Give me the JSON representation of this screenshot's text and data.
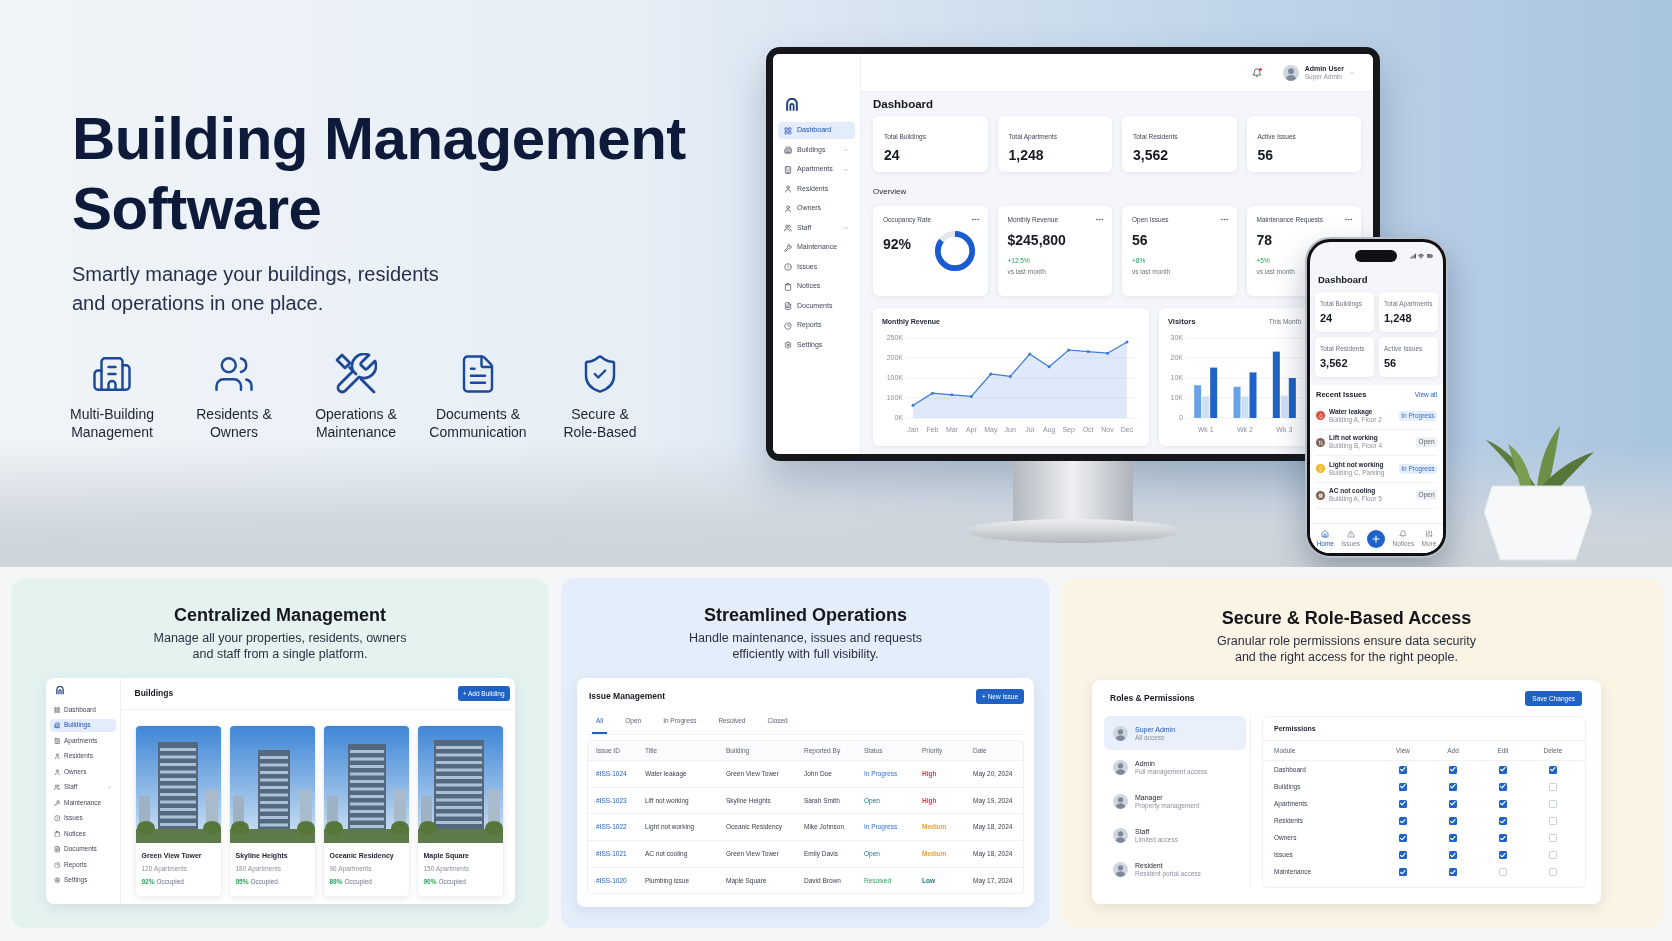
{
  "hero": {
    "title": "Building Management\nSoftware",
    "subtitle": "Smartly manage your buildings, residents\nand operations in one place.",
    "features": [
      {
        "label": "Multi-Building\nManagement"
      },
      {
        "label": "Residents &\nOwners"
      },
      {
        "label": "Operations &\nMaintenance"
      },
      {
        "label": "Documents &\nCommunication"
      },
      {
        "label": "Secure &\nRole-Based"
      }
    ]
  },
  "monitor": {
    "header": {
      "has_notification": true,
      "user_name": "Admin User",
      "user_role": "Super Admin"
    },
    "sidebar": [
      {
        "label": "Dashboard",
        "selected": true,
        "expandable": false
      },
      {
        "label": "Buildings",
        "selected": false,
        "expandable": true
      },
      {
        "label": "Apartments",
        "selected": false,
        "expandable": true
      },
      {
        "label": "Residents",
        "selected": false,
        "expandable": false
      },
      {
        "label": "Owners",
        "selected": false,
        "expandable": false
      },
      {
        "label": "Staff",
        "selected": false,
        "expandable": true
      },
      {
        "label": "Maintenance",
        "selected": false,
        "expandable": false
      },
      {
        "label": "Issues",
        "selected": false,
        "expandable": false
      },
      {
        "label": "Notices",
        "selected": false,
        "expandable": false
      },
      {
        "label": "Documents",
        "selected": false,
        "expandable": false
      },
      {
        "label": "Reports",
        "selected": false,
        "expandable": false
      },
      {
        "label": "Settings",
        "selected": false,
        "expandable": false
      }
    ],
    "page_title": "Dashboard",
    "stats": [
      {
        "label": "Total Buildings",
        "value": "24"
      },
      {
        "label": "Total Apartments",
        "value": "1,248"
      },
      {
        "label": "Total Residents",
        "value": "3,562"
      },
      {
        "label": "Active Issues",
        "value": "56"
      }
    ],
    "overview_title": "Overview",
    "overview": [
      {
        "kind": "donut",
        "label": "Occupancy Rate",
        "value": "92%",
        "level": 0.85
      },
      {
        "kind": "trend",
        "label": "Monthly Revenue",
        "value": "$245,800",
        "change": "+12.5%",
        "note": "vs last month"
      },
      {
        "kind": "trend",
        "label": "Open Issues",
        "value": "56",
        "change": "+8%",
        "note": "vs last month"
      },
      {
        "kind": "trend",
        "label": "Maintenance Requests",
        "value": "78",
        "change": "+5%",
        "note": "vs last month"
      }
    ],
    "revenue_chart": {
      "title": "Monthly Revenue",
      "y_labels": [
        "250K",
        "200K",
        "100K",
        "100K",
        "0K"
      ],
      "x_labels": [
        "Jan",
        "Feb",
        "Mar",
        "Apr",
        "May",
        "Jun",
        "Jul",
        "Aug",
        "Sep",
        "Oct",
        "Nov",
        "Dec"
      ]
    },
    "visitors_chart": {
      "title": "Visitors",
      "filter": "This Month",
      "y_labels": [
        "30K",
        "20K",
        "10K",
        "10K",
        "0"
      ],
      "x_labels": [
        "Wk 1",
        "Wk 2",
        "Wk 3"
      ]
    }
  },
  "phone": {
    "title": "Dashboard",
    "stats": [
      {
        "label": "Total Buildings",
        "value": "24"
      },
      {
        "label": "Total Apartments",
        "value": "1,248"
      },
      {
        "label": "Total Residents",
        "value": "3,562"
      },
      {
        "label": "Active Issues",
        "value": "56"
      }
    ],
    "recent_title": "Recent Issues",
    "view_all": "View all",
    "issues": [
      {
        "title": "Water leakage",
        "location": "Building A, Floor 2",
        "status": "In Progress",
        "kind": "in_progress"
      },
      {
        "title": "Lift not working",
        "location": "Building B, Floor 4",
        "status": "Open",
        "kind": "open"
      },
      {
        "title": "Light not working",
        "location": "Building C, Parking",
        "status": "In Progress",
        "kind": "in_progress"
      },
      {
        "title": "AC not cooling",
        "location": "Building A, Floor 5",
        "status": "Open",
        "kind": "open"
      }
    ],
    "nav": [
      {
        "label": "Home",
        "selected": true
      },
      {
        "label": "Issues",
        "selected": false
      },
      {
        "label": "Notices",
        "selected": false
      },
      {
        "label": "More",
        "selected": false
      }
    ]
  },
  "management_card": {
    "title": "Centralized Management",
    "description": "Manage all your properties, residents, owners\nand staff from a single platform.",
    "sidebar": [
      {
        "label": "Dashboard",
        "selected": false,
        "expandable": false
      },
      {
        "label": "Buildings",
        "selected": true,
        "expandable": false
      },
      {
        "label": "Apartments",
        "selected": false,
        "expandable": false
      },
      {
        "label": "Residents",
        "selected": false,
        "expandable": false
      },
      {
        "label": "Owners",
        "selected": false,
        "expandable": false
      },
      {
        "label": "Staff",
        "selected": false,
        "expandable": true
      },
      {
        "label": "Maintenance",
        "selected": false,
        "expandable": false
      },
      {
        "label": "Issues",
        "selected": false,
        "expandable": false
      },
      {
        "label": "Notices",
        "selected": false,
        "expandable": false
      },
      {
        "label": "Documents",
        "selected": false,
        "expandable": false
      },
      {
        "label": "Reports",
        "selected": false,
        "expandable": false
      },
      {
        "label": "Settings",
        "selected": false,
        "expandable": false
      }
    ],
    "page_title": "Buildings",
    "add_button": "+ Add Building",
    "buildings": [
      {
        "name": "Green View Tower",
        "apartments": "120 Apartments",
        "occupancy": "92%",
        "occupied_label": "Occupied"
      },
      {
        "name": "Skyline Heights",
        "apartments": "180 Apartments",
        "occupancy": "95%",
        "occupied_label": "Occupied"
      },
      {
        "name": "Oceanic Residency",
        "apartments": "96 Apartments",
        "occupancy": "89%",
        "occupied_label": "Occupied"
      },
      {
        "name": "Maple Square",
        "apartments": "150 Apartments",
        "occupancy": "90%",
        "occupied_label": "Occupied"
      }
    ]
  },
  "operations_card": {
    "title": "Streamlined Operations",
    "description": "Handle maintenance, issues and requests\nefficiently with full visibility.",
    "panel_title": "Issue Management",
    "new_button": "+ New Issue",
    "tabs": [
      {
        "label": "All",
        "selected": true
      },
      {
        "label": "Open",
        "selected": false
      },
      {
        "label": "In Progress",
        "selected": false
      },
      {
        "label": "Resolved",
        "selected": false
      },
      {
        "label": "Closed",
        "selected": false
      }
    ],
    "columns": [
      "Issue ID",
      "Title",
      "Building",
      "Reported By",
      "Status",
      "Priority",
      "Date"
    ],
    "rows": [
      {
        "id": "#ISS-1024",
        "title": "Water leakage",
        "building": "Green View Tower",
        "reported_by": "John Doe",
        "status": {
          "text": "In Progress",
          "kind": "in_progress"
        },
        "priority": {
          "text": "High",
          "kind": "high"
        },
        "date": "May 20, 2024"
      },
      {
        "id": "#ISS-1023",
        "title": "Lift not working",
        "building": "Skyline Heights",
        "reported_by": "Sarah Smith",
        "status": {
          "text": "Open",
          "kind": "open"
        },
        "priority": {
          "text": "High",
          "kind": "high"
        },
        "date": "May 19, 2024"
      },
      {
        "id": "#ISS-1022",
        "title": "Light not working",
        "building": "Oceanic Residency",
        "reported_by": "Mike Johnson",
        "status": {
          "text": "In Progress",
          "kind": "in_progress"
        },
        "priority": {
          "text": "Medium",
          "kind": "medium"
        },
        "date": "May 18, 2024"
      },
      {
        "id": "#ISS-1021",
        "title": "AC not cooling",
        "building": "Green View Tower",
        "reported_by": "Emily Davis",
        "status": {
          "text": "Open",
          "kind": "open"
        },
        "priority": {
          "text": "Medium",
          "kind": "medium"
        },
        "date": "May 18, 2024"
      },
      {
        "id": "#ISS-1020",
        "title": "Plumbing issue",
        "building": "Maple Square",
        "reported_by": "David Brown",
        "status": {
          "text": "Resolved",
          "kind": "resolved"
        },
        "priority": {
          "text": "Low",
          "kind": "low"
        },
        "date": "May 17, 2024"
      }
    ]
  },
  "access_card": {
    "title": "Secure & Role-Based Access",
    "description": "Granular role permissions ensure data security\nand the right access for the right people.",
    "panel_title": "Roles & Permissions",
    "save_button": "Save Changes",
    "roles": [
      {
        "name": "Super Admin",
        "description": "All access",
        "selected": true
      },
      {
        "name": "Admin",
        "description": "Full management access",
        "selected": false
      },
      {
        "name": "Manager",
        "description": "Property management",
        "selected": false
      },
      {
        "name": "Staff",
        "description": "Limited access",
        "selected": false
      },
      {
        "name": "Resident",
        "description": "Resident portal access",
        "selected": false
      }
    ],
    "permissions_title": "Permissions",
    "columns": [
      "Module",
      "View",
      "Add",
      "Edit",
      "Delete"
    ],
    "rows": [
      {
        "module": "Dashboard",
        "view": true,
        "add": true,
        "edit": true,
        "delete": true
      },
      {
        "module": "Buildings",
        "view": true,
        "add": true,
        "edit": true,
        "delete": false
      },
      {
        "module": "Apartments",
        "view": true,
        "add": true,
        "edit": true,
        "delete": false
      },
      {
        "module": "Residents",
        "view": true,
        "add": true,
        "edit": true,
        "delete": false
      },
      {
        "module": "Owners",
        "view": true,
        "add": true,
        "edit": true,
        "delete": false
      },
      {
        "module": "Issues",
        "view": true,
        "add": true,
        "edit": true,
        "delete": false
      },
      {
        "module": "Maintenance",
        "view": true,
        "add": true,
        "edit": false,
        "delete": false
      }
    ]
  }
}
